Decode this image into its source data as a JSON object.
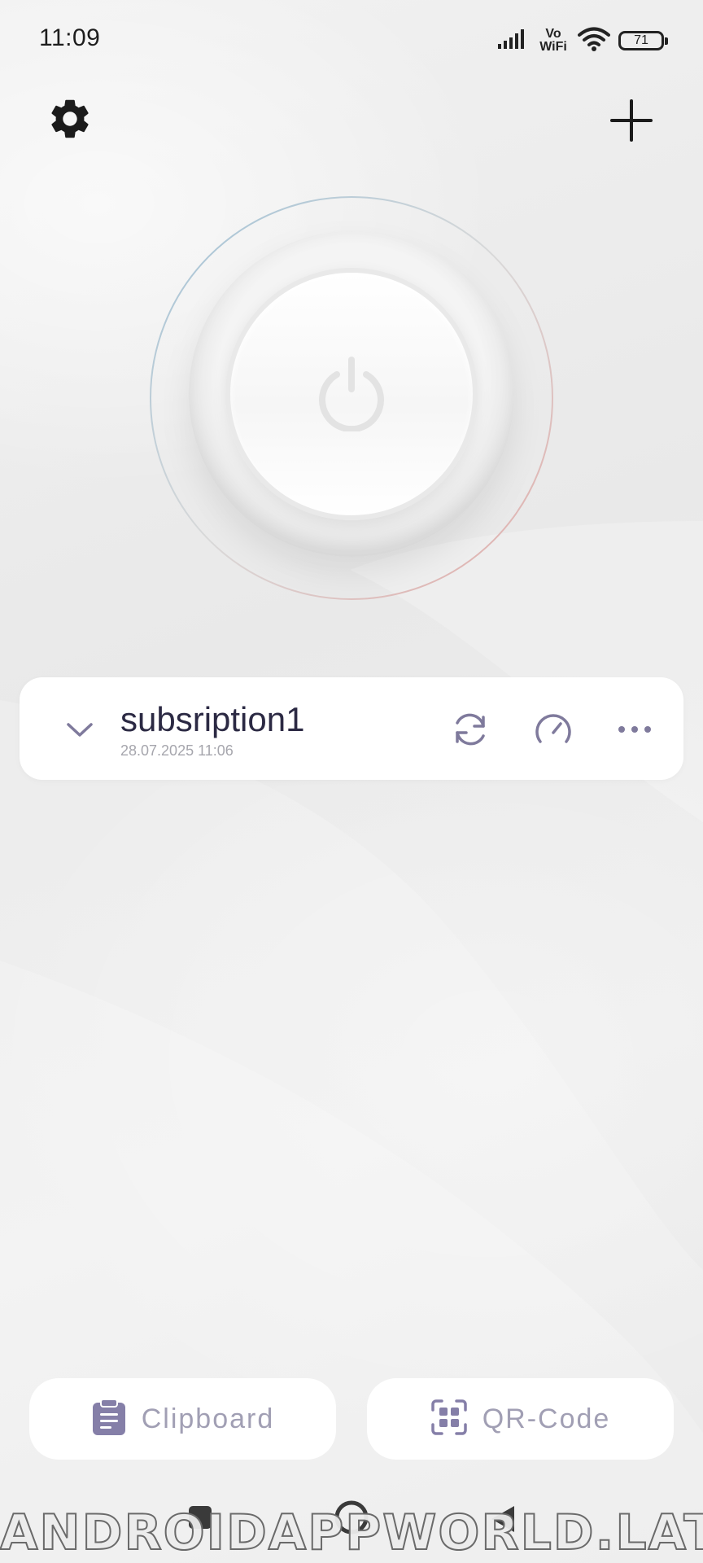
{
  "status_bar": {
    "time": "11:09",
    "vowifi_top": "Vo",
    "vowifi_bottom": "WiFi",
    "battery": "71",
    "icons": [
      "signal-icon",
      "wifi-icon",
      "battery-icon"
    ]
  },
  "top_bar": {
    "settings_icon": "gear-icon",
    "add_icon": "plus-icon"
  },
  "power": {
    "icon": "power-icon",
    "state": "off"
  },
  "subscription": {
    "name": "subsription1",
    "updated": "28.07.2025 11:06",
    "icons": [
      "chevron-down-icon",
      "refresh-icon",
      "speedometer-icon",
      "more-horizontal-icon"
    ]
  },
  "bottom_actions": {
    "clipboard_label": "Clipboard",
    "qr_label": "QR-Code"
  },
  "watermark": "ANDROIDAPPWORLD.LAT",
  "colors": {
    "accent_text": "#2b2943",
    "muted_icon": "#7f7a9c",
    "button_label": "#a19fb4",
    "background": "#ececec"
  }
}
